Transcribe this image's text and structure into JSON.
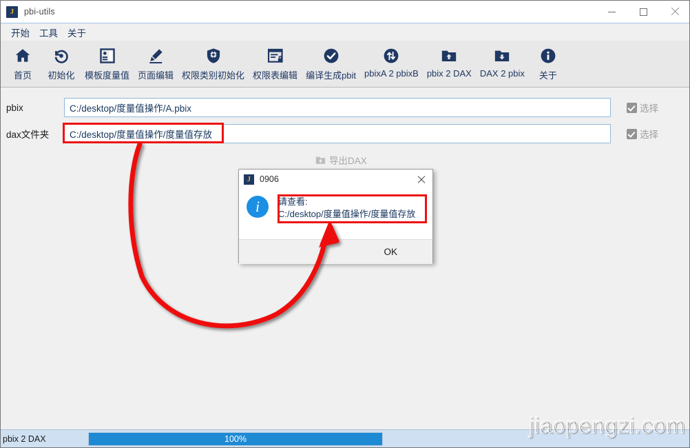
{
  "window": {
    "title": "pbi-utils",
    "app_icon": "app-j-icon",
    "minimize": "minimize-icon",
    "maximize": "maximize-icon",
    "close": "close-icon"
  },
  "menubar": {
    "items": [
      {
        "label": "开始"
      },
      {
        "label": "工具"
      },
      {
        "label": "关于"
      }
    ]
  },
  "toolbar": {
    "items": [
      {
        "label": "首页",
        "icon": "home-icon"
      },
      {
        "label": "初始化",
        "icon": "refresh-counterclockwise-icon"
      },
      {
        "label": "模板度量值",
        "icon": "template-panel-icon"
      },
      {
        "label": "页面编辑",
        "icon": "pencil-edit-icon"
      },
      {
        "label": "权限类别初始化",
        "icon": "shield-gear-icon"
      },
      {
        "label": "权限表编辑",
        "icon": "document-lock-icon"
      },
      {
        "label": "编译生成pbit",
        "icon": "check-circle-icon"
      },
      {
        "label": "pbixA 2 pbixB",
        "icon": "transfer-arrows-circle-icon"
      },
      {
        "label": "pbix 2 DAX",
        "icon": "folder-up-arrow-icon"
      },
      {
        "label": "DAX 2 pbix",
        "icon": "folder-down-arrow-icon"
      },
      {
        "label": "关于",
        "icon": "info-circle-icon"
      }
    ]
  },
  "form": {
    "fields": [
      {
        "label": "pbix",
        "value": "C:/desktop/度量值操作/A.pbix",
        "placeholder": "",
        "checkbox_label": "选择",
        "checkbox_checked": true,
        "checkbox_disabled": true
      },
      {
        "label": "dax文件夹",
        "value": "C:/desktop/度量值操作/度量值存放",
        "placeholder": "",
        "checkbox_label": "选择",
        "checkbox_checked": true,
        "checkbox_disabled": true
      }
    ],
    "export_button": {
      "label": "导出DAX",
      "icon": "folder-up-arrow-icon",
      "disabled": true
    }
  },
  "dialog": {
    "title": "0906",
    "icon": "app-j-icon",
    "close_icon": "close-icon",
    "info_icon": "info-circle-icon",
    "message_line1": "请查看:",
    "message_line2": "C:/desktop/度量值操作/度量值存放",
    "ok_label": "OK"
  },
  "statusbar": {
    "task_label": "pbix 2 DAX",
    "progress_text": "100%",
    "progress_percent": 100
  },
  "watermark": {
    "text": "jiaopengzi.com"
  },
  "annotations": {
    "colors": {
      "highlight_red": "#ee1111",
      "accent_blue": "#1f8ad4",
      "brand_navy": "#1f3864",
      "brand_gold": "#e8b923"
    }
  }
}
